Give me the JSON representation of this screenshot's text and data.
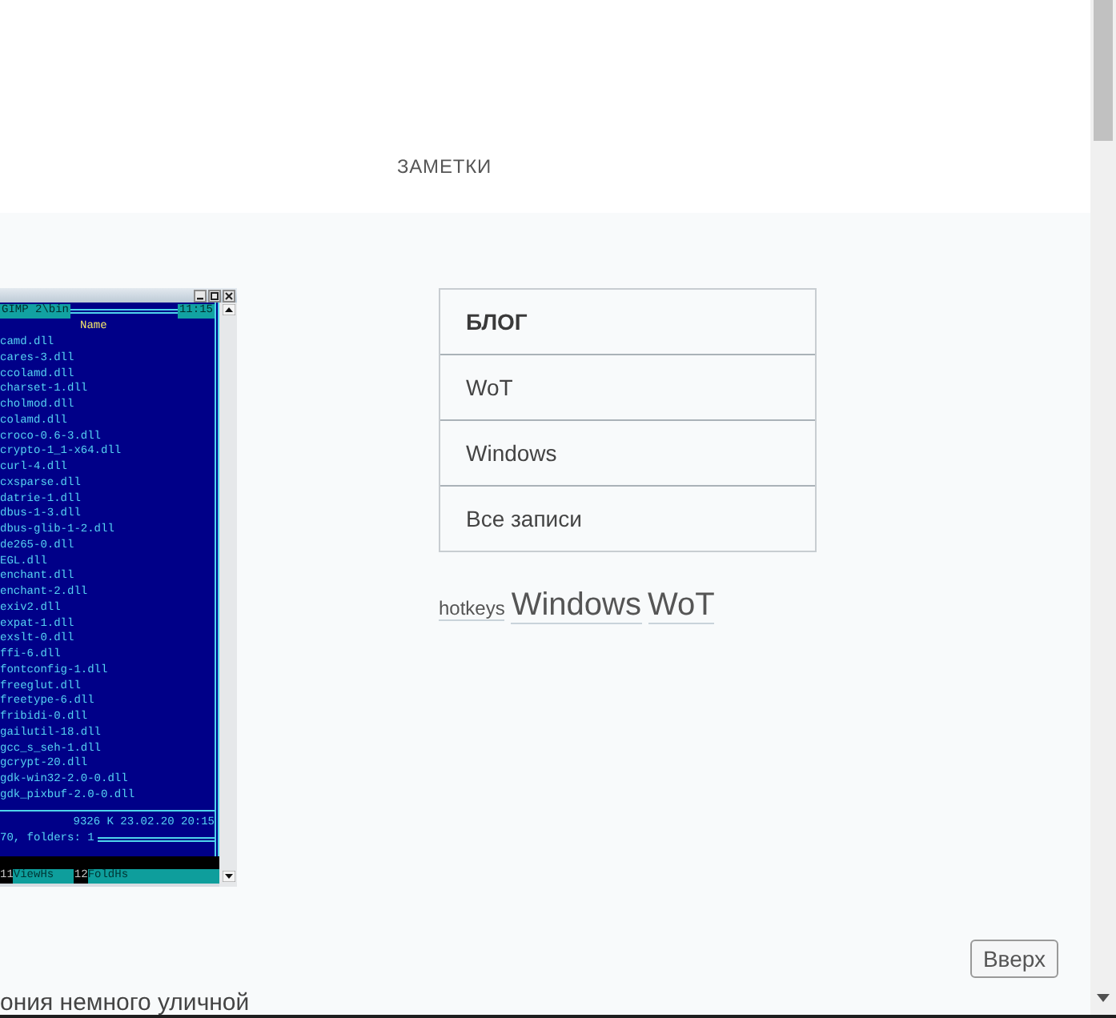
{
  "header": {
    "nav_link": "ЗАМЕТКИ"
  },
  "post_image": {
    "path": "GIMP 2\\bin",
    "clock": "11:15",
    "column_header": "Name",
    "files": [
      "camd.dll",
      "cares-3.dll",
      "ccolamd.dll",
      "charset-1.dll",
      "cholmod.dll",
      "colamd.dll",
      "croco-0.6-3.dll",
      "crypto-1_1-x64.dll",
      "curl-4.dll",
      "cxsparse.dll",
      "datrie-1.dll",
      "dbus-1-3.dll",
      "dbus-glib-1-2.dll",
      "de265-0.dll",
      "EGL.dll",
      "enchant.dll",
      "enchant-2.dll",
      "exiv2.dll",
      "expat-1.dll",
      "exslt-0.dll",
      "ffi-6.dll",
      "fontconfig-1.dll",
      "freeglut.dll",
      "freetype-6.dll",
      "fribidi-0.dll",
      "gailutil-18.dll",
      "gcc_s_seh-1.dll",
      "gcrypt-20.dll",
      "gdk-win32-2.0-0.dll",
      "gdk_pixbuf-2.0-0.dll"
    ],
    "file_info": "9326 K 23.02.20 20:15",
    "summary": "70, folders: 1",
    "keybar": [
      {
        "key": "11",
        "label": "ViewHs"
      },
      {
        "key": "12",
        "label": "FoldHs"
      }
    ]
  },
  "sidebar": {
    "title": "БЛОГ",
    "items": [
      "WoT",
      "Windows",
      "Все записи"
    ]
  },
  "tags": [
    {
      "label": "hotkeys",
      "kind": "small"
    },
    {
      "label": "Windows",
      "kind": "large"
    },
    {
      "label": "WoT",
      "kind": "large"
    }
  ],
  "back_to_top": "Вверх",
  "post_text": "ония немного уличной"
}
